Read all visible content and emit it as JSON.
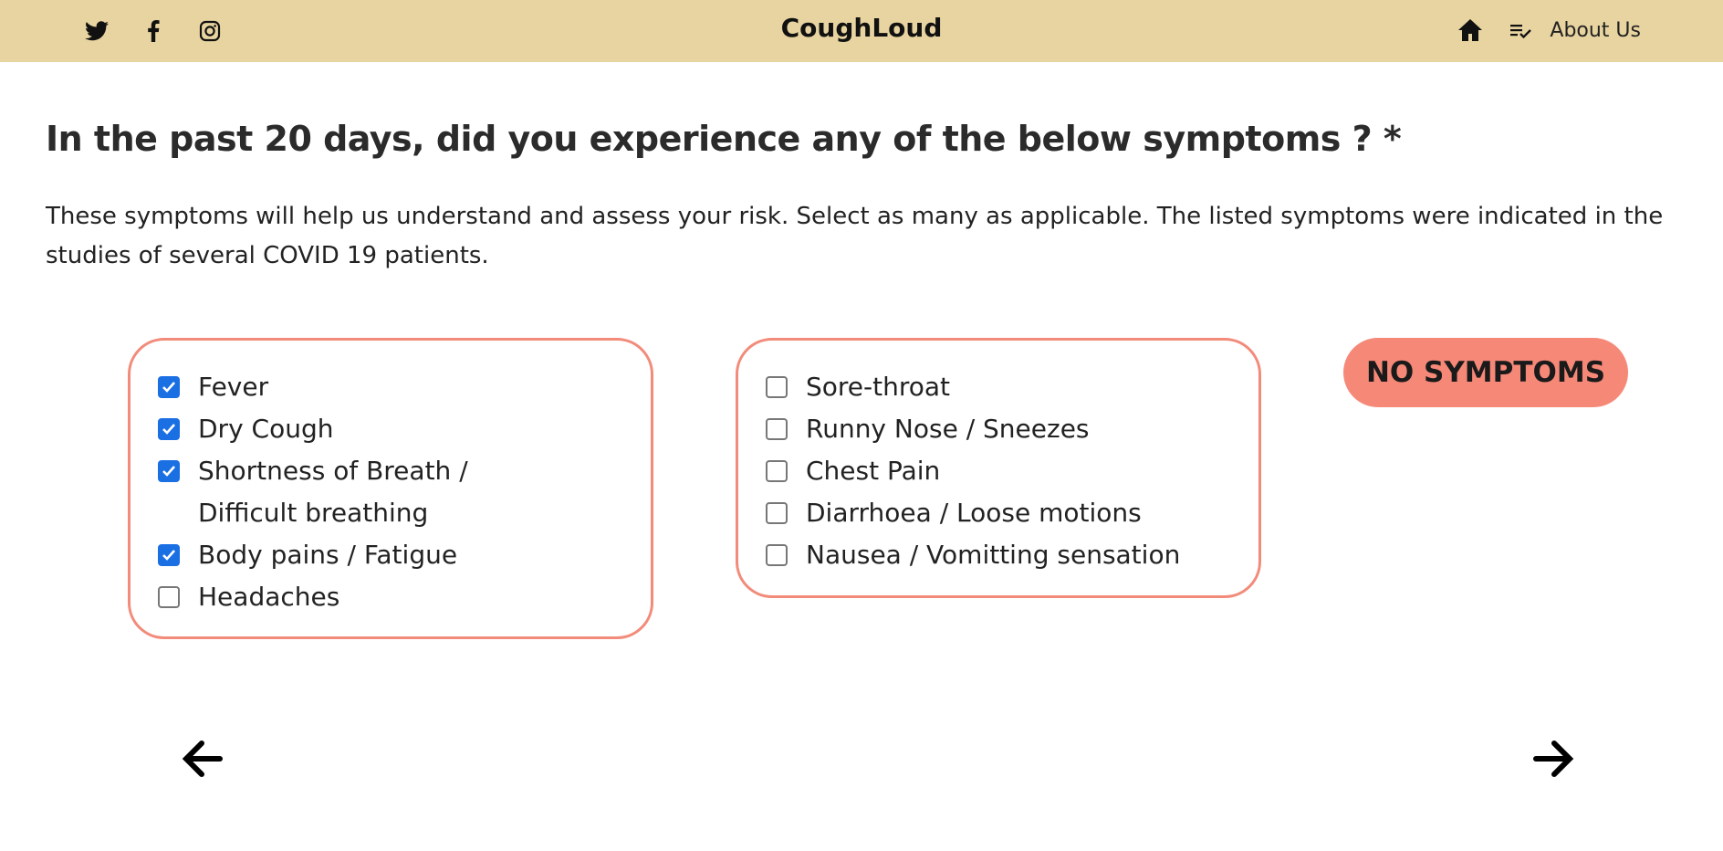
{
  "header": {
    "brand": "CoughLoud",
    "social_icons": [
      "twitter-icon",
      "facebook-icon",
      "instagram-icon"
    ],
    "nav_icons": [
      "home-icon",
      "list-check-icon"
    ],
    "about_label": "About Us",
    "background_color": "#e8d4a0"
  },
  "question": {
    "title": "In the past 20 days, did you experience any of the below symptoms ? *",
    "description": "These symptoms will help us understand and assess your risk. Select as many as applicable. The listed symptoms were indicated in the studies of several COVID 19 patients."
  },
  "symptoms_left": [
    {
      "label": "Fever",
      "checked": true
    },
    {
      "label": "Dry Cough",
      "checked": true
    },
    {
      "label": "Shortness of Breath / Difficult breathing",
      "checked": true
    },
    {
      "label": "Body pains / Fatigue",
      "checked": true
    },
    {
      "label": "Headaches",
      "checked": false
    }
  ],
  "symptoms_right": [
    {
      "label": "Sore-throat",
      "checked": false
    },
    {
      "label": "Runny Nose / Sneezes",
      "checked": false
    },
    {
      "label": "Chest Pain",
      "checked": false
    },
    {
      "label": "Diarrhoea / Loose motions",
      "checked": false
    },
    {
      "label": "Nausea / Vomitting sensation",
      "checked": false
    }
  ],
  "no_symptoms_label": "NO SYMPTOMS",
  "navigation": {
    "back_icon": "arrow-left-icon",
    "next_icon": "arrow-right-icon"
  },
  "colors": {
    "accent": "#f68878",
    "border": "#f28b7a",
    "checkbox": "#1a6fe3"
  }
}
